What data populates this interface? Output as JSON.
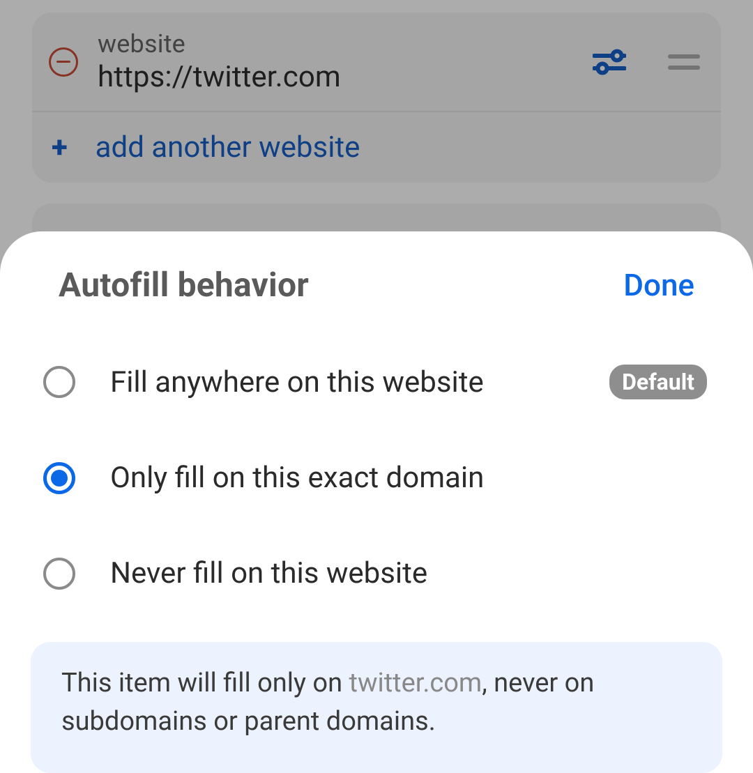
{
  "website_card": {
    "field_label": "website",
    "field_value": "https://twitter.com",
    "add_label": "add another website"
  },
  "sheet": {
    "title": "Autofill behavior",
    "done": "Done",
    "options": [
      {
        "label": "Fill anywhere on this website",
        "default_badge": "Default",
        "selected": false
      },
      {
        "label": "Only fill on this exact domain",
        "selected": true
      },
      {
        "label": "Never fill on this website",
        "selected": false
      }
    ],
    "info_prefix": "This item will fill only on ",
    "info_domain": "twitter.com",
    "info_suffix": ", never on subdomains or parent domains."
  }
}
